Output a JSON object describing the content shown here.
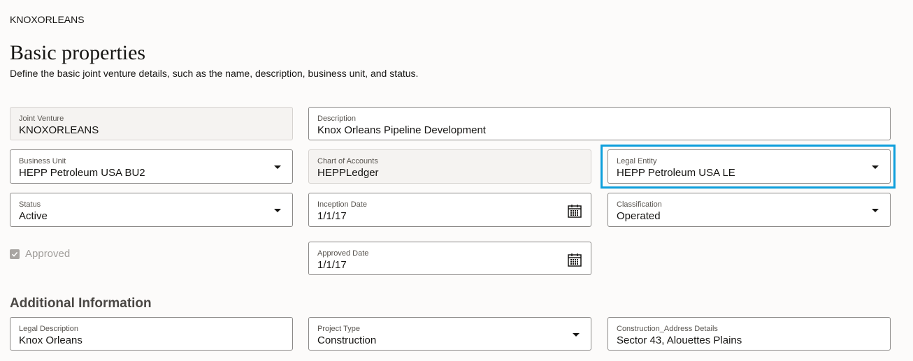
{
  "breadcrumb": "KNOXORLEANS",
  "page": {
    "title": "Basic properties",
    "description": "Define the basic joint venture details, such as the name, description, business unit, and status."
  },
  "fields": {
    "joint_venture": {
      "label": "Joint Venture",
      "value": "KNOXORLEANS"
    },
    "description": {
      "label": "Description",
      "value": "Knox Orleans Pipeline Development"
    },
    "business_unit": {
      "label": "Business Unit",
      "value": "HEPP Petroleum USA BU2"
    },
    "chart_of_accounts": {
      "label": "Chart of Accounts",
      "value": "HEPPLedger"
    },
    "legal_entity": {
      "label": "Legal Entity",
      "value": "HEPP Petroleum USA LE"
    },
    "status": {
      "label": "Status",
      "value": "Active"
    },
    "inception_date": {
      "label": "Inception Date",
      "value": "1/1/17"
    },
    "classification": {
      "label": "Classification",
      "value": "Operated"
    },
    "approved": {
      "label": "Approved",
      "checked": true
    },
    "approved_date": {
      "label": "Approved Date",
      "value": "1/1/17"
    }
  },
  "additional": {
    "title": "Additional Information",
    "legal_description": {
      "label": "Legal Description",
      "value": "Knox Orleans"
    },
    "project_type": {
      "label": "Project Type",
      "value": "Construction"
    },
    "construction_address": {
      "label": "Construction_Address Details",
      "value": "Sector 43, Alouettes Plains"
    }
  },
  "colors": {
    "highlight": "#0e9fdc",
    "background": "#fcfbfa"
  }
}
